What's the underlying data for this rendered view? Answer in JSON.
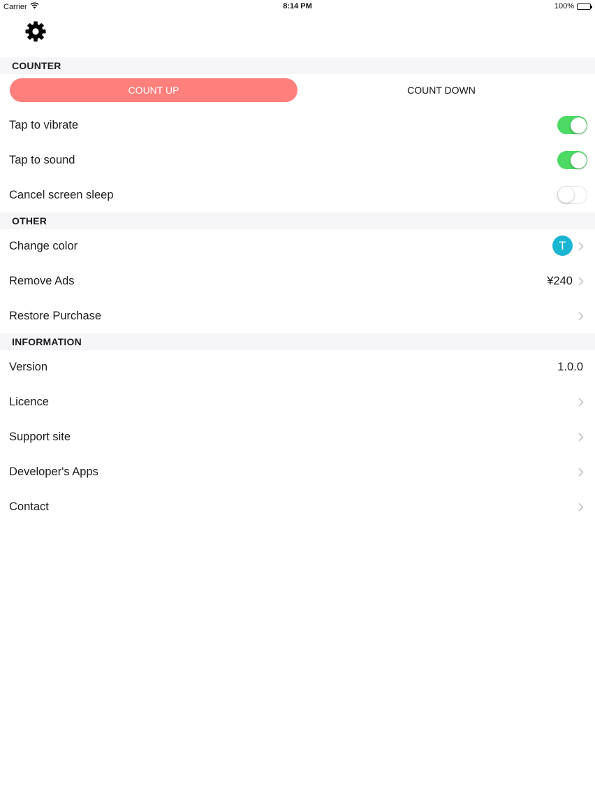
{
  "status_bar": {
    "carrier": "Carrier",
    "time": "8:14 PM",
    "battery": "100%"
  },
  "icons": {
    "settings": "gear-icon",
    "wifi": "wifi-icon",
    "battery": "battery-icon",
    "chevron": "chevron-right-icon"
  },
  "colors": {
    "accent": "#fe7f7b",
    "toggle_on": "#4cd964",
    "color_badge": "#1ab5d3"
  },
  "counter": {
    "header": "COUNTER",
    "segments": [
      "COUNT UP",
      "COUNT DOWN"
    ],
    "selected": "COUNT UP",
    "rows": [
      {
        "label": "Tap to vibrate",
        "enabled": true
      },
      {
        "label": "Tap to sound",
        "enabled": true
      },
      {
        "label": "Cancel screen sleep",
        "enabled": false
      }
    ]
  },
  "other": {
    "header": "OTHER",
    "rows": [
      {
        "label": "Change color",
        "badge": "T"
      },
      {
        "label": "Remove Ads",
        "value": "¥240"
      },
      {
        "label": "Restore Purchase"
      }
    ]
  },
  "information": {
    "header": "INFORMATION",
    "rows": [
      {
        "label": "Version",
        "value": "1.0.0"
      },
      {
        "label": "Licence"
      },
      {
        "label": "Support site"
      },
      {
        "label": "Developer's Apps"
      },
      {
        "label": "Contact"
      }
    ]
  }
}
